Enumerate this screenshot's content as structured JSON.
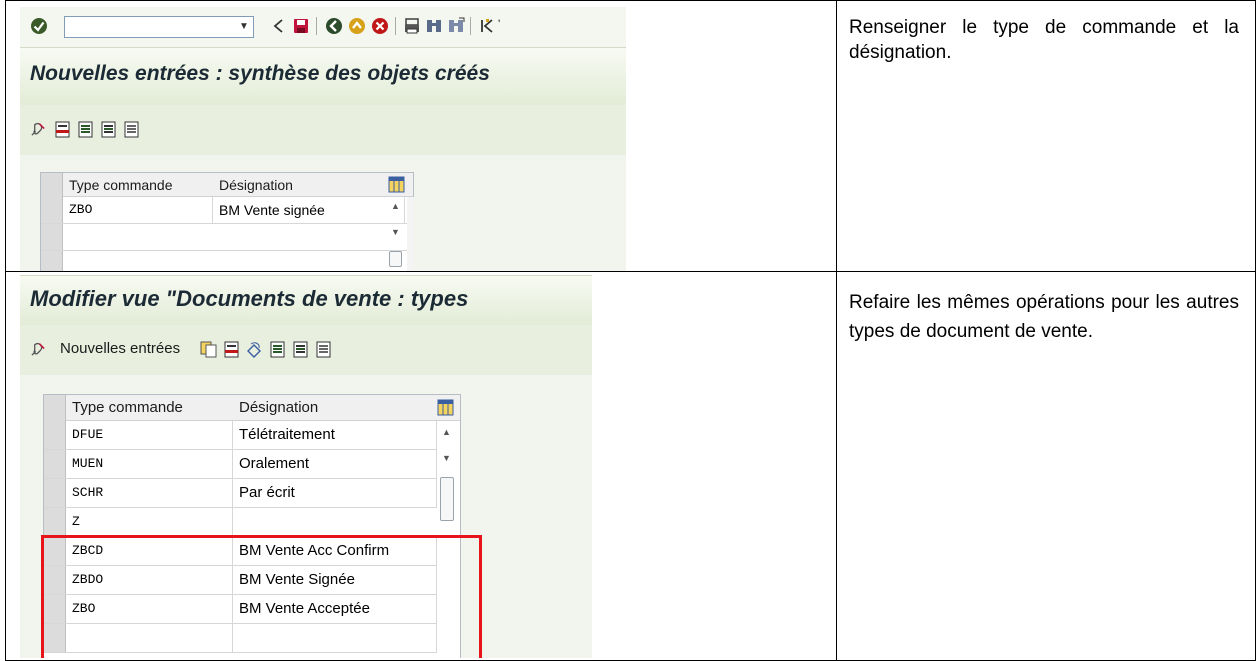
{
  "rows": [
    {
      "sap": {
        "toolbar": {
          "command_field_value": "",
          "icons": [
            "check-icon",
            "back-arrow-icon",
            "save-icon",
            "back-icon",
            "exit-icon",
            "cancel-icon",
            "print-icon",
            "find-icon",
            "find-next-icon",
            "first-page-icon"
          ]
        },
        "title": "Nouvelles entrées : synthèse des objets créés",
        "app_toolbar": {
          "icons": [
            "change-display-icon",
            "delete-icon",
            "select-all-icon",
            "select-block-icon",
            "deselect-all-icon"
          ]
        },
        "table": {
          "columns": [
            "Type commande",
            "Désignation"
          ],
          "rows": [
            {
              "type": "ZBO",
              "designation": "BM Vente signée"
            },
            {
              "type": "",
              "designation": ""
            },
            {
              "type": "",
              "designation": ""
            }
          ]
        }
      },
      "instruction": "Renseigner le type de commande et la désignation."
    },
    {
      "sap": {
        "title": "Modifier vue \"Documents de vente : types",
        "app_toolbar": {
          "new_entries_label": "Nouvelles entrées",
          "icons": [
            "copy-icon",
            "delete-icon",
            "undo-icon",
            "select-all-icon",
            "select-block-icon",
            "deselect-all-icon"
          ]
        },
        "table": {
          "columns": [
            "Type commande",
            "Désignation"
          ],
          "rows": [
            {
              "type": "DFUE",
              "designation": "Télétraitement"
            },
            {
              "type": "MUEN",
              "designation": "Oralement"
            },
            {
              "type": "SCHR",
              "designation": "Par écrit"
            },
            {
              "type": "Z",
              "designation": ""
            },
            {
              "type": "ZBCD",
              "designation": "BM Vente Acc Confirm"
            },
            {
              "type": "ZBDO",
              "designation": "BM Vente Signée"
            },
            {
              "type": "ZBO",
              "designation": "BM Vente Acceptée"
            }
          ]
        },
        "highlight_color": "#e8141c"
      },
      "instruction": "Refaire les mêmes opérations pour les autres types de document de vente."
    }
  ]
}
